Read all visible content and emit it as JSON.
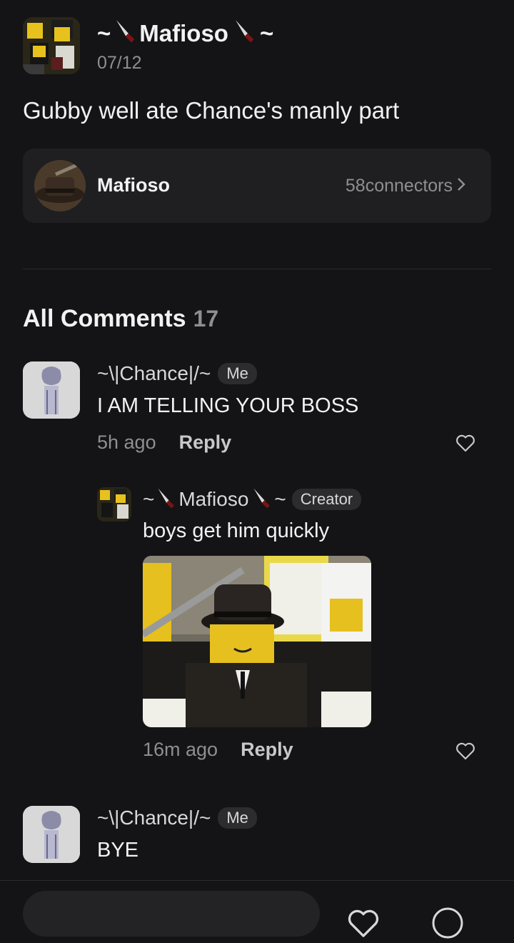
{
  "post": {
    "author_prefix": "~",
    "author_name": "Mafioso",
    "author_suffix": "~",
    "author_avatar_icon": "roblox-avatar-yellow-icon",
    "date": "07/12",
    "text": "Gubby well ate Chance's manly part"
  },
  "community": {
    "name": "Mafioso",
    "connectors": "58connectors",
    "avatar_icon": "fedora-hat-avatar-icon"
  },
  "comments_header": {
    "title": "All Comments",
    "count": "17"
  },
  "comments": [
    {
      "author": "~\\|Chance|/~",
      "badge": "Me",
      "text": "I AM TELLING YOUR BOSS",
      "time": "5h ago",
      "reply_label": "Reply"
    },
    {
      "author_prefix": "~",
      "author_name": "Mafioso",
      "author_suffix": "~",
      "badge": "Creator",
      "text": "boys get him quickly",
      "image_icon": "mafioso-roblox-image",
      "time": "16m ago",
      "reply_label": "Reply"
    },
    {
      "author": "~\\|Chance|/~",
      "badge": "Me",
      "text": "BYE"
    }
  ],
  "colors": {
    "background": "#141416",
    "card": "#1f1f22",
    "muted": "#8e8e93",
    "chip": "#2c2c2e"
  }
}
